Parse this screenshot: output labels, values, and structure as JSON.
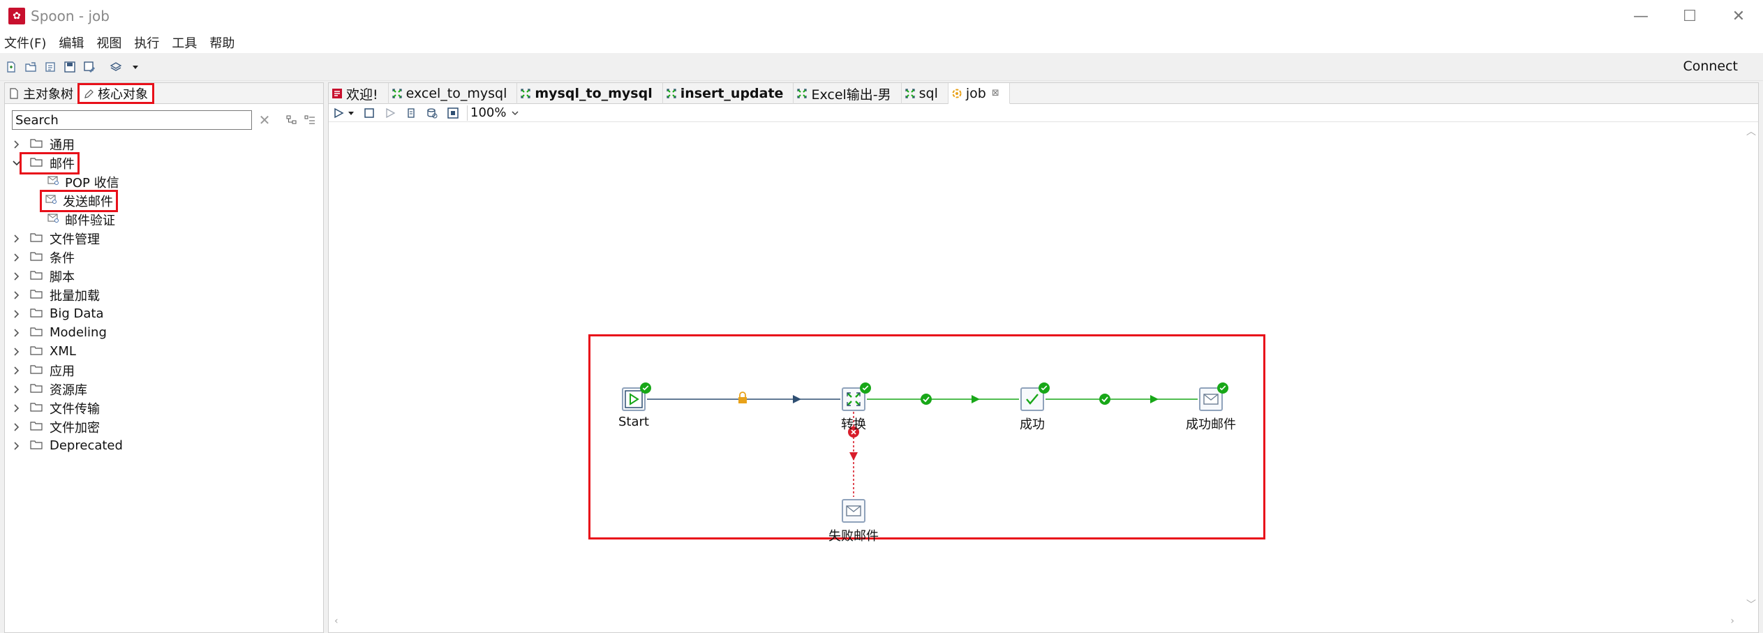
{
  "window": {
    "title": "Spoon - job",
    "app_icon_glyph": "✿",
    "controls": {
      "minimize": "—",
      "maximize": "☐",
      "close": "✕"
    }
  },
  "menu": [
    "文件(F)",
    "编辑",
    "视图",
    "执行",
    "工具",
    "帮助"
  ],
  "toolbar": {
    "icons": [
      "new-file-icon",
      "open-icon",
      "explore-icon",
      "save-icon",
      "save-as-icon",
      "layers-icon",
      "dropdown-icon"
    ],
    "connect_label": "Connect"
  },
  "left_panel": {
    "tabs": [
      {
        "label": "主对象树",
        "icon": "document-icon",
        "active": false
      },
      {
        "label": "核心对象",
        "icon": "pencil-icon",
        "active": true
      }
    ],
    "search": {
      "placeholder": "Search",
      "value": "",
      "clear": "✕"
    },
    "tree": [
      {
        "label": "通用",
        "type": "folder",
        "expanded": false
      },
      {
        "label": "邮件",
        "type": "folder",
        "expanded": true,
        "highlighted": true
      },
      {
        "label": "POP 收信",
        "type": "leaf"
      },
      {
        "label": "发送邮件",
        "type": "leaf",
        "highlighted": true
      },
      {
        "label": "邮件验证",
        "type": "leaf"
      },
      {
        "label": "文件管理",
        "type": "folder",
        "expanded": false
      },
      {
        "label": "条件",
        "type": "folder",
        "expanded": false
      },
      {
        "label": "脚本",
        "type": "folder",
        "expanded": false
      },
      {
        "label": "批量加载",
        "type": "folder",
        "expanded": false
      },
      {
        "label": "Big Data",
        "type": "folder",
        "expanded": false
      },
      {
        "label": "Modeling",
        "type": "folder",
        "expanded": false
      },
      {
        "label": "XML",
        "type": "folder",
        "expanded": false
      },
      {
        "label": "应用",
        "type": "folder",
        "expanded": false
      },
      {
        "label": "资源库",
        "type": "folder",
        "expanded": false
      },
      {
        "label": "文件传输",
        "type": "folder",
        "expanded": false
      },
      {
        "label": "文件加密",
        "type": "folder",
        "expanded": false
      },
      {
        "label": "Deprecated",
        "type": "folder",
        "expanded": false
      }
    ]
  },
  "editor": {
    "tabs": [
      {
        "label": "欢迎!",
        "icon": "spoon-icon",
        "bold": false,
        "active": false
      },
      {
        "label": "excel_to_mysql",
        "icon": "transformation-icon",
        "bold": false,
        "active": false
      },
      {
        "label": "mysql_to_mysql",
        "icon": "transformation-icon",
        "bold": true,
        "active": false
      },
      {
        "label": "insert_update",
        "icon": "transformation-icon",
        "bold": true,
        "active": false
      },
      {
        "label": "Excel输出-男",
        "icon": "transformation-icon",
        "bold": false,
        "active": false
      },
      {
        "label": "sql",
        "icon": "transformation-icon",
        "bold": false,
        "active": false
      },
      {
        "label": "job",
        "icon": "job-icon",
        "bold": false,
        "active": true,
        "close": "⊠"
      }
    ],
    "zoom": "100%",
    "canvas": {
      "nodes": [
        {
          "id": "start",
          "label": "Start",
          "icon": "play-icon",
          "status": "ok"
        },
        {
          "id": "transform",
          "label": "转换",
          "icon": "transformation-icon",
          "status": "ok"
        },
        {
          "id": "success",
          "label": "成功",
          "icon": "check-icon",
          "status": "ok"
        },
        {
          "id": "success_mail",
          "label": "成功邮件",
          "icon": "mail-icon",
          "status": "ok"
        },
        {
          "id": "fail_mail",
          "label": "失败邮件",
          "icon": "mail-icon",
          "status": "none"
        }
      ],
      "hops": [
        {
          "from": "start",
          "to": "transform",
          "kind": "unconditional",
          "color": "#2f4f72"
        },
        {
          "from": "transform",
          "to": "success",
          "kind": "on-success",
          "color": "#1fa51f"
        },
        {
          "from": "success",
          "to": "success_mail",
          "kind": "on-success",
          "color": "#1fa51f"
        },
        {
          "from": "transform",
          "to": "fail_mail",
          "kind": "on-failure",
          "color": "#d81d2a"
        }
      ]
    }
  },
  "colors": {
    "highlight": "#e8101a",
    "success": "#18a718",
    "failure": "#d81d2a",
    "unconditional": "#2f4f72",
    "lock": "#e8a21a"
  }
}
